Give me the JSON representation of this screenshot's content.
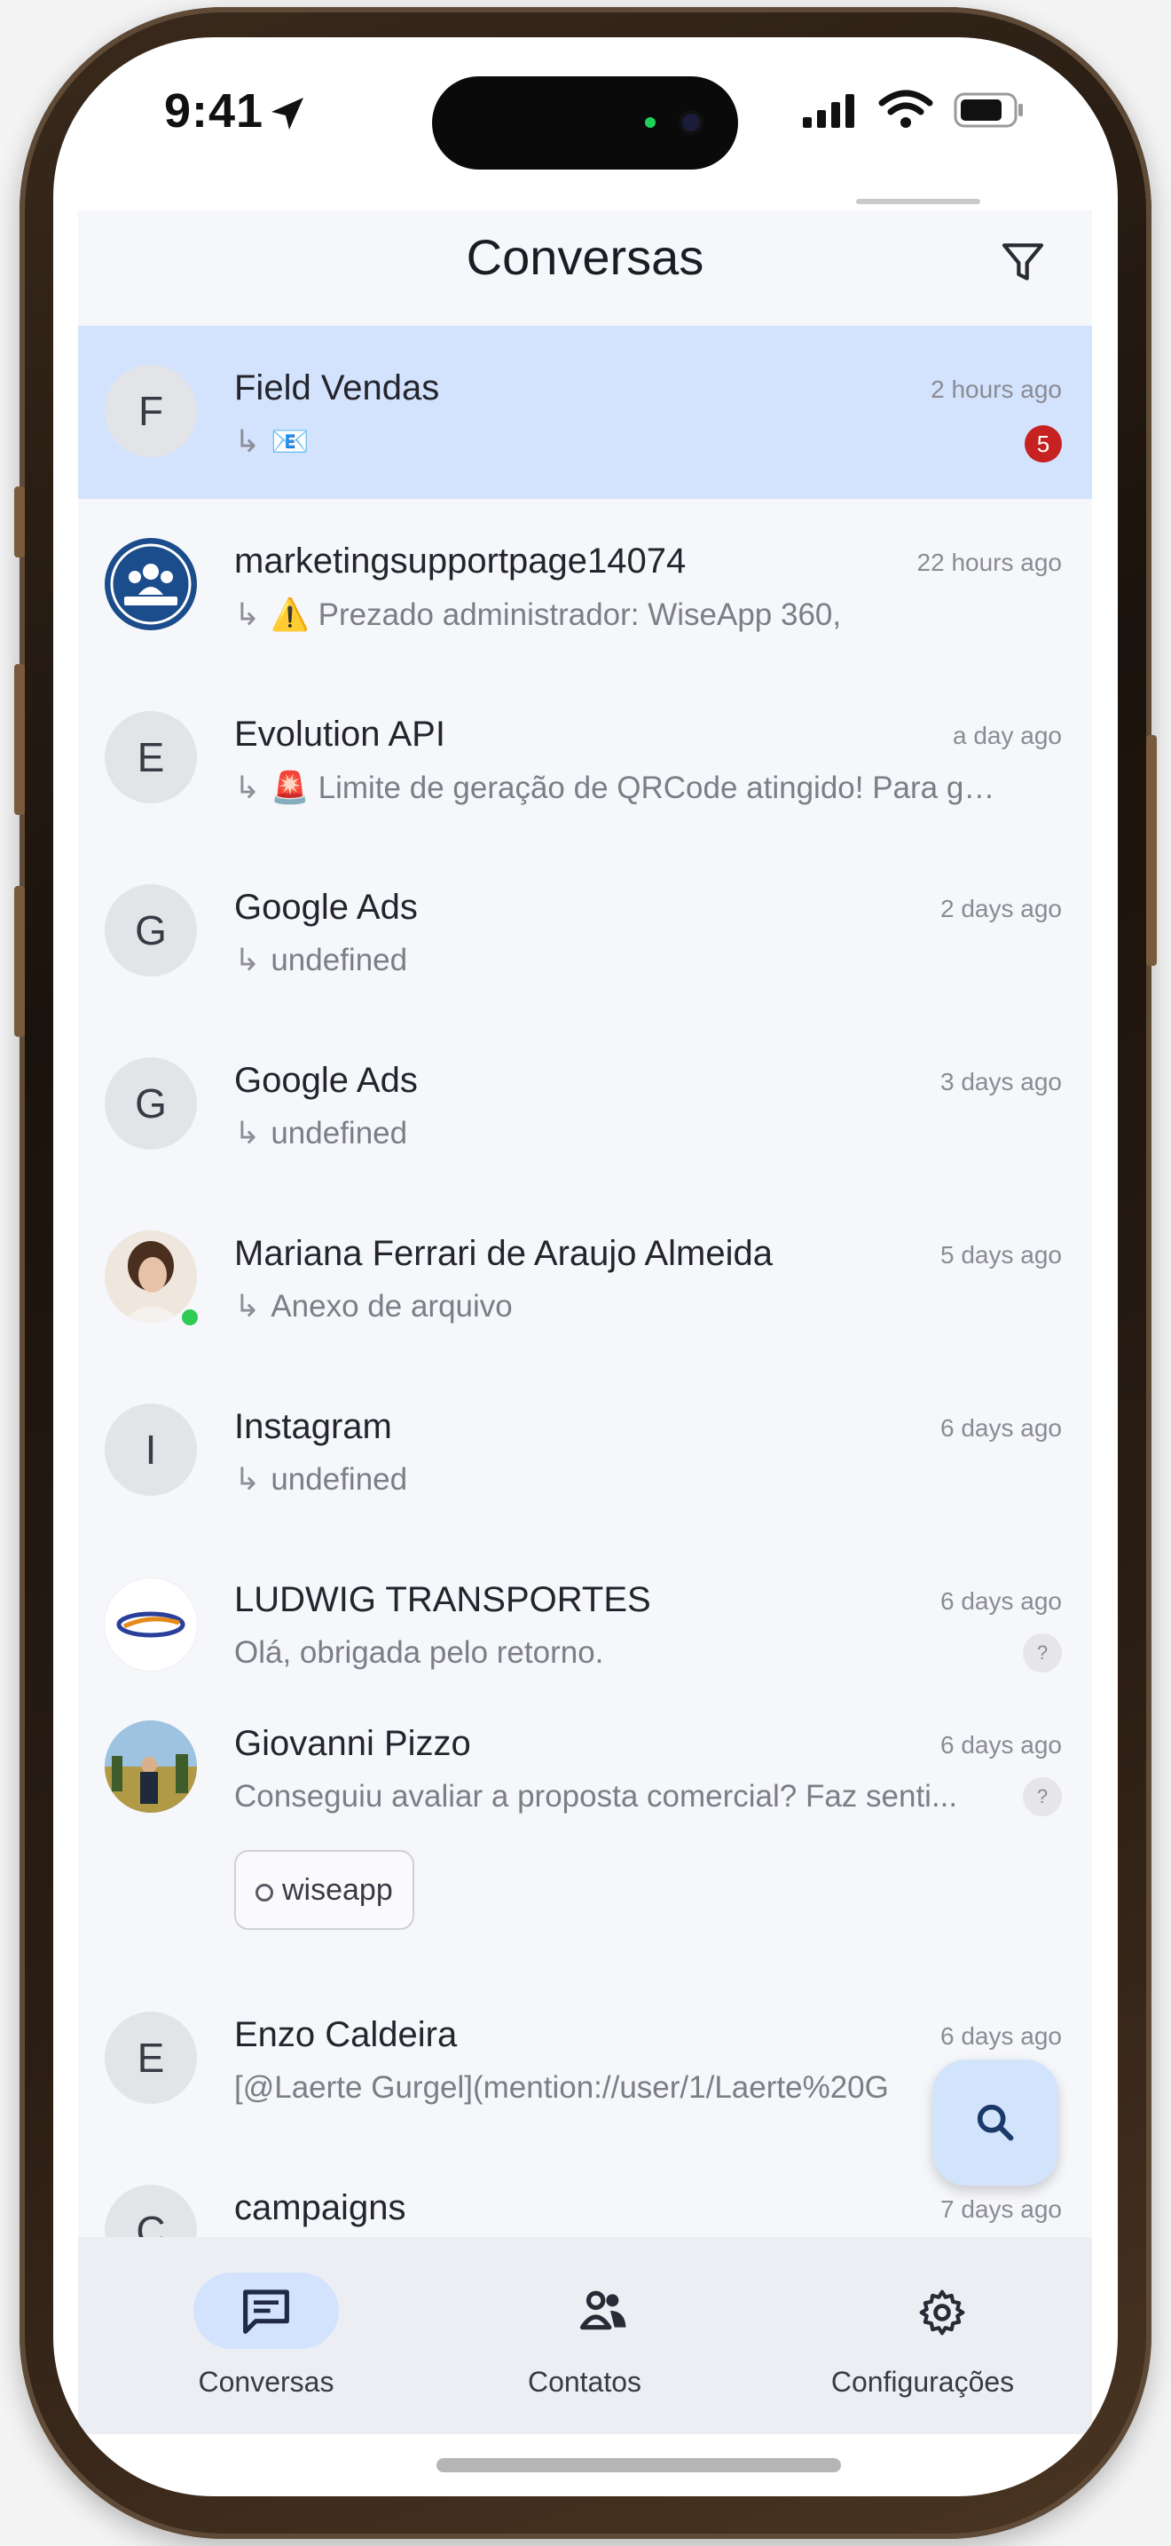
{
  "status_bar": {
    "time": "9:41"
  },
  "header": {
    "title": "Conversas"
  },
  "conversations": [
    {
      "initial": "F",
      "name": "Field Vendas",
      "time": "2 hours ago",
      "preview_icon": "📧",
      "preview": "",
      "unread_badge": "5",
      "selected": true
    },
    {
      "initial": "",
      "name": "marketingsupportpage14074",
      "time": "22 hours ago",
      "preview_icon": "⚠️",
      "preview": "Prezado administrador: WiseApp 360,"
    },
    {
      "initial": "E",
      "name": "Evolution API",
      "time": "a day ago",
      "preview_icon": "🚨",
      "preview": "Limite de geração de QRCode atingido! Para ger..."
    },
    {
      "initial": "G",
      "name": "Google Ads",
      "time": "2 days ago",
      "preview": "undefined"
    },
    {
      "initial": "G",
      "name": "Google Ads",
      "time": "3 days ago",
      "preview": "undefined"
    },
    {
      "initial": "",
      "name": "Mariana Ferrari de Araujo Almeida",
      "time": "5 days ago",
      "preview": "Anexo de arquivo"
    },
    {
      "initial": "I",
      "name": "Instagram",
      "time": "6 days ago",
      "preview": "undefined"
    },
    {
      "initial": "",
      "name": "LUDWIG TRANSPORTES",
      "time": "6 days ago",
      "preview": "Olá, obrigada pelo retorno.",
      "badge": "?"
    },
    {
      "initial": "",
      "name": "Giovanni Pizzo",
      "time": "6 days ago",
      "preview": "Conseguiu avaliar a proposta comercial? Faz senti...",
      "badge": "?",
      "chip": "wiseapp"
    },
    {
      "initial": "E",
      "name": "Enzo Caldeira",
      "time": "6 days ago",
      "preview": "[@Laerte Gurgel](mention://user/1/Laerte%20G"
    },
    {
      "initial": "C",
      "name": "campaigns",
      "time": "7 days ago",
      "preview": ""
    }
  ],
  "bottom_nav": [
    {
      "label": "Conversas",
      "icon": "chat-icon",
      "active": true
    },
    {
      "label": "Contatos",
      "icon": "contacts-icon",
      "active": false
    },
    {
      "label": "Configurações",
      "icon": "gear-icon",
      "active": false
    }
  ],
  "colors": {
    "selected_row": "#d3e3fd",
    "badge_red": "#c62222",
    "fab": "#d2e3fc"
  }
}
